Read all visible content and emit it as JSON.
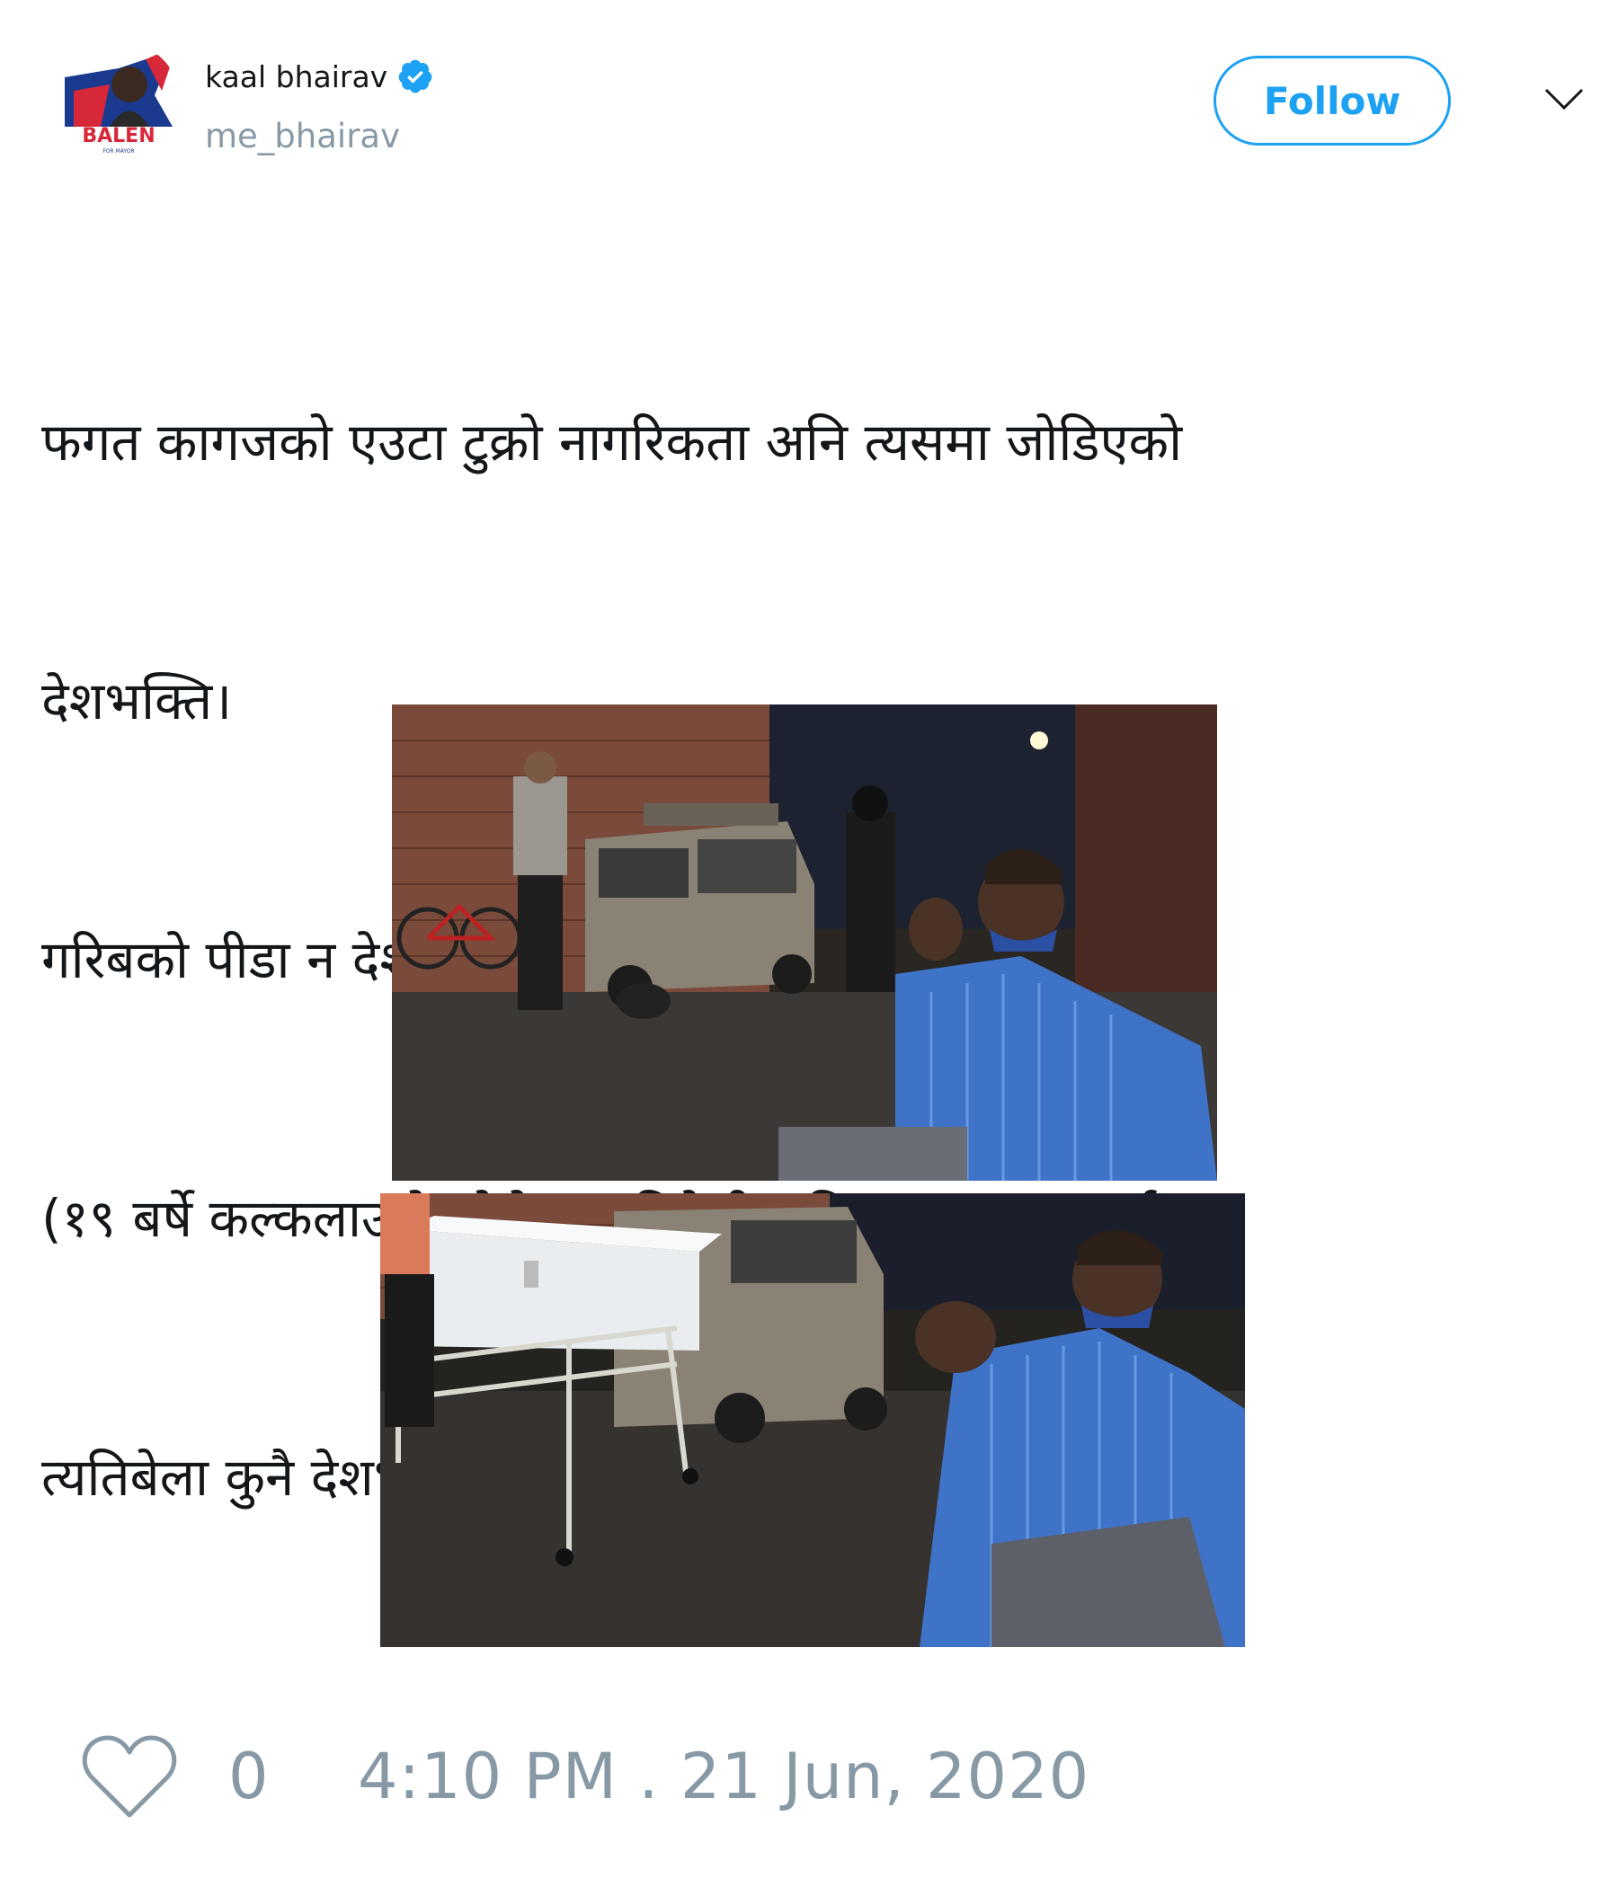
{
  "author": {
    "display_name": "kaal bhairav",
    "username": "me_bhairav",
    "avatar_text": "BALEN",
    "avatar_subtext": "FOR MAYOR",
    "verified": true
  },
  "actions": {
    "follow_label": "Follow"
  },
  "tweet": {
    "text_lines": [
      "फगत कागजको एउटा टुक्रो नागरिकता अनि त्यसमा जोडिएको",
      "देशभक्ति।",
      "गरिबको पीडा न देशभक्ति भएर सुख पाए, न देशद्रोहि भएर।",
      "(१९ बर्षे कल्कलाउदो छोरो जब बिदेशी भुमिमा मृत्युवरण गर्छ,",
      "त्यतिबेला कुनै देशभक्तिको नाराले मन शान्त पार्न सक्दैन)"
    ]
  },
  "footer": {
    "like_count": "0",
    "timestamp": "4:10 PM . 21 Jun, 2020"
  },
  "colors": {
    "accent": "#1da1f2",
    "muted": "#8899a6",
    "text": "#14171a"
  },
  "icons": {
    "verified": "verified-badge-icon",
    "chevron": "chevron-down-icon",
    "like": "heart-icon"
  }
}
